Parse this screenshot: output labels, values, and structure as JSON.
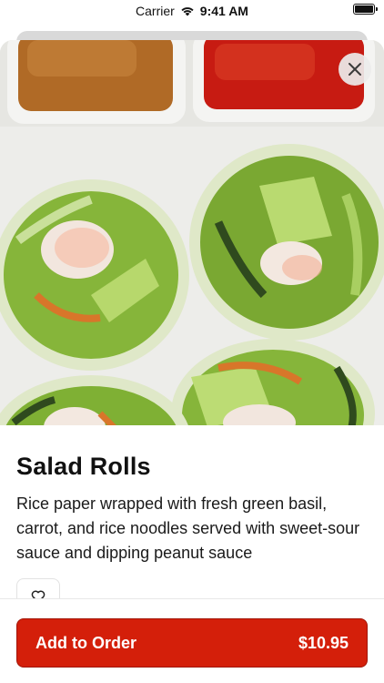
{
  "status_bar": {
    "carrier": "Carrier",
    "time": "9:41 AM"
  },
  "item": {
    "name": "Salad Rolls",
    "description": "Rice paper wrapped with fresh green basil, carrot, and rice noodles served with sweet-sour sauce and dipping peanut sauce"
  },
  "order_button": {
    "label": "Add to Order",
    "price": "$10.95"
  },
  "icons": {
    "close": "close-icon",
    "favorite": "heart-outline-icon",
    "wifi": "wifi-icon",
    "battery": "battery-icon"
  },
  "colors": {
    "accent": "#d41f0a",
    "text": "#111111"
  }
}
